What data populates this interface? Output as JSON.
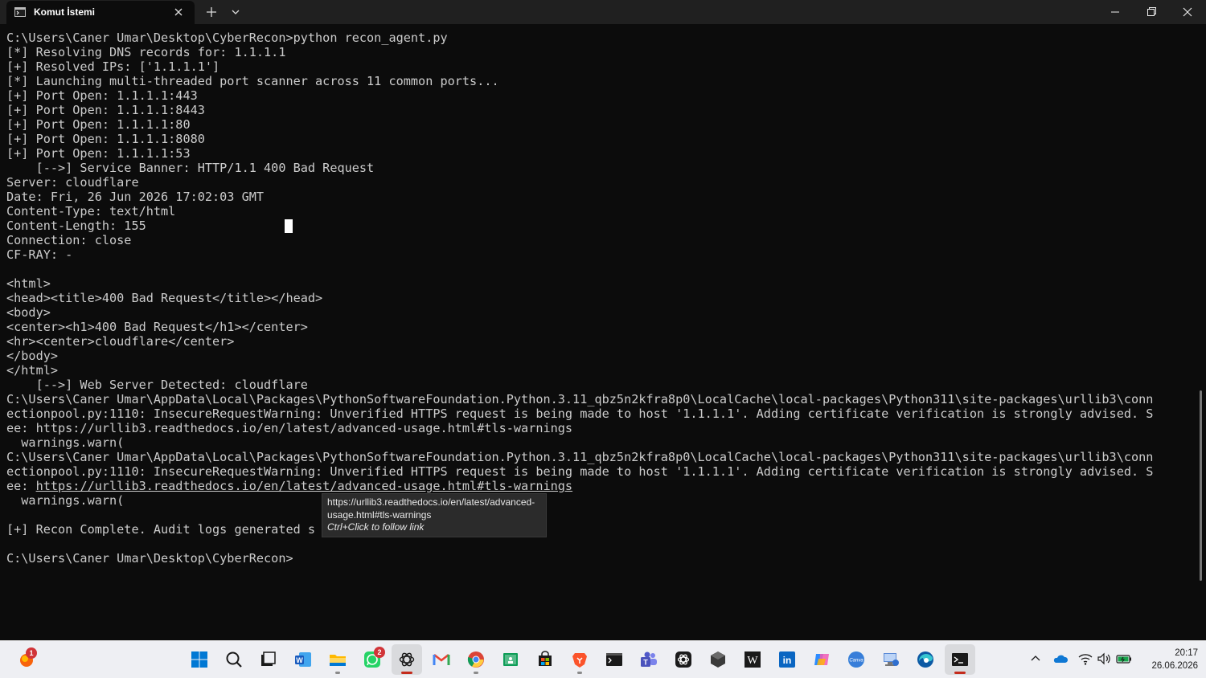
{
  "window": {
    "tab_title": "Komut İstemi",
    "icons": {
      "tab": "terminal-icon",
      "close_tab": "close-icon",
      "new_tab": "plus-icon",
      "dropdown": "chevron-down-icon",
      "minimize": "minimize-icon",
      "maximize": "restore-icon",
      "close": "close-icon"
    }
  },
  "terminal": {
    "lines": [
      "C:\\Users\\Caner Umar\\Desktop\\CyberRecon>python recon_agent.py",
      "[*] Resolving DNS records for: 1.1.1.1",
      "[+] Resolved IPs: ['1.1.1.1']",
      "[*] Launching multi-threaded port scanner across 11 common ports...",
      "[+] Port Open: 1.1.1.1:443",
      "[+] Port Open: 1.1.1.1:8443",
      "[+] Port Open: 1.1.1.1:80",
      "[+] Port Open: 1.1.1.1:8080",
      "[+] Port Open: 1.1.1.1:53",
      "    [-->] Service Banner: HTTP/1.1 400 Bad Request",
      "Server: cloudflare",
      "Date: Fri, 26 Jun 2026 17:02:03 GMT",
      "Content-Type: text/html",
      "Content-Length: 155",
      "Connection: close",
      "CF-RAY: -",
      "",
      "<html>",
      "<head><title>400 Bad Request</title></head>",
      "<body>",
      "<center><h1>400 Bad Request</h1></center>",
      "<hr><center>cloudflare</center>",
      "</body>",
      "</html>",
      "    [-->] Web Server Detected: cloudflare",
      "C:\\Users\\Caner Umar\\AppData\\Local\\Packages\\PythonSoftwareFoundation.Python.3.11_qbz5n2kfra8p0\\LocalCache\\local-packages\\Python311\\site-packages\\urllib3\\conn",
      "ectionpool.py:1110: InsecureRequestWarning: Unverified HTTPS request is being made to host '1.1.1.1'. Adding certificate verification is strongly advised. S",
      "ee: https://urllib3.readthedocs.io/en/latest/advanced-usage.html#tls-warnings",
      "  warnings.warn(",
      "C:\\Users\\Caner Umar\\AppData\\Local\\Packages\\PythonSoftwareFoundation.Python.3.11_qbz5n2kfra8p0\\LocalCache\\local-packages\\Python311\\site-packages\\urllib3\\conn",
      "ectionpool.py:1110: InsecureRequestWarning: Unverified HTTPS request is being made to host '1.1.1.1'. Adding certificate verification is strongly advised. S",
      "ee: ",
      "  warnings.warn(",
      "",
      "[+] Recon Complete. Audit logs generated s",
      "",
      "C:\\Users\\Caner Umar\\Desktop\\CyberRecon>"
    ],
    "hover_link": "https://urllib3.readthedocs.io/en/latest/advanced-usage.html#tls-warnings"
  },
  "tooltip": {
    "url_line1": "https://urllib3.readthedocs.io/en/latest/advanced-",
    "url_line2": "usage.html#tls-warnings",
    "hint": "Ctrl+Click to follow link"
  },
  "taskbar": {
    "apps": [
      "start-icon",
      "search-icon",
      "task-view-icon",
      "word-icon",
      "file-explorer-icon",
      "whatsapp-icon",
      "chatgpt-icon",
      "gmail-icon",
      "chrome-icon",
      "classroom-icon",
      "store-icon",
      "brave-icon",
      "terminal-app-icon",
      "teams-icon",
      "chatgpt-app-icon",
      "obsidian-icon",
      "wikipedia-icon",
      "linkedin-icon",
      "copilot-icon",
      "canva-icon",
      "remote-desktop-icon",
      "edge-icon",
      "command-prompt-icon"
    ],
    "notification_badge": "1",
    "whatsapp_badge": "2",
    "canva_label": "Canva",
    "wikipedia_label": "W",
    "linkedin_label": "in",
    "time": "20:17",
    "date": "26.06.2026",
    "tray": [
      "chevron-up-icon",
      "onedrive-icon",
      "wifi-icon",
      "volume-icon",
      "battery-icon"
    ]
  },
  "colors": {
    "terminal_bg": "#0c0c0c",
    "terminal_text": "#cccccc",
    "titlebar_bg": "#202020",
    "taskbar_bg": "#eeeff3",
    "active_indicator": "#c42b1c"
  }
}
